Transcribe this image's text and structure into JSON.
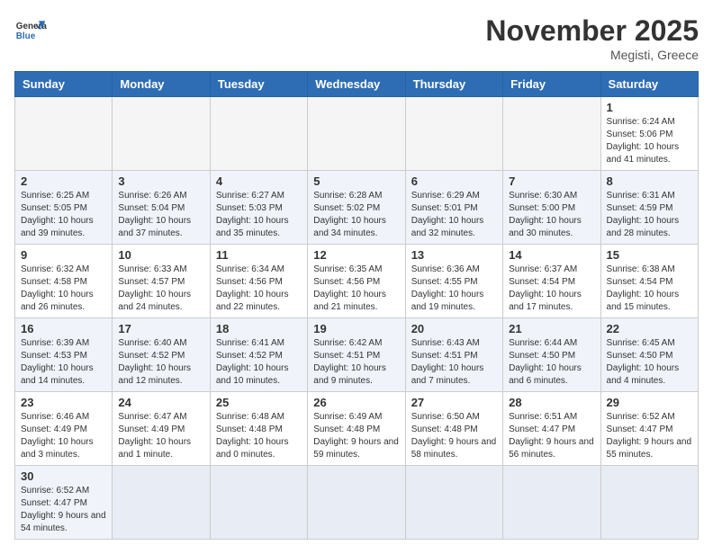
{
  "header": {
    "logo_general": "General",
    "logo_blue": "Blue",
    "month_title": "November 2025",
    "subtitle": "Megisti, Greece"
  },
  "weekdays": [
    "Sunday",
    "Monday",
    "Tuesday",
    "Wednesday",
    "Thursday",
    "Friday",
    "Saturday"
  ],
  "weeks": [
    [
      {
        "day": "",
        "info": ""
      },
      {
        "day": "",
        "info": ""
      },
      {
        "day": "",
        "info": ""
      },
      {
        "day": "",
        "info": ""
      },
      {
        "day": "",
        "info": ""
      },
      {
        "day": "",
        "info": ""
      },
      {
        "day": "1",
        "info": "Sunrise: 6:24 AM\nSunset: 5:06 PM\nDaylight: 10 hours and 41 minutes."
      }
    ],
    [
      {
        "day": "2",
        "info": "Sunrise: 6:25 AM\nSunset: 5:05 PM\nDaylight: 10 hours and 39 minutes."
      },
      {
        "day": "3",
        "info": "Sunrise: 6:26 AM\nSunset: 5:04 PM\nDaylight: 10 hours and 37 minutes."
      },
      {
        "day": "4",
        "info": "Sunrise: 6:27 AM\nSunset: 5:03 PM\nDaylight: 10 hours and 35 minutes."
      },
      {
        "day": "5",
        "info": "Sunrise: 6:28 AM\nSunset: 5:02 PM\nDaylight: 10 hours and 34 minutes."
      },
      {
        "day": "6",
        "info": "Sunrise: 6:29 AM\nSunset: 5:01 PM\nDaylight: 10 hours and 32 minutes."
      },
      {
        "day": "7",
        "info": "Sunrise: 6:30 AM\nSunset: 5:00 PM\nDaylight: 10 hours and 30 minutes."
      },
      {
        "day": "8",
        "info": "Sunrise: 6:31 AM\nSunset: 4:59 PM\nDaylight: 10 hours and 28 minutes."
      }
    ],
    [
      {
        "day": "9",
        "info": "Sunrise: 6:32 AM\nSunset: 4:58 PM\nDaylight: 10 hours and 26 minutes."
      },
      {
        "day": "10",
        "info": "Sunrise: 6:33 AM\nSunset: 4:57 PM\nDaylight: 10 hours and 24 minutes."
      },
      {
        "day": "11",
        "info": "Sunrise: 6:34 AM\nSunset: 4:56 PM\nDaylight: 10 hours and 22 minutes."
      },
      {
        "day": "12",
        "info": "Sunrise: 6:35 AM\nSunset: 4:56 PM\nDaylight: 10 hours and 21 minutes."
      },
      {
        "day": "13",
        "info": "Sunrise: 6:36 AM\nSunset: 4:55 PM\nDaylight: 10 hours and 19 minutes."
      },
      {
        "day": "14",
        "info": "Sunrise: 6:37 AM\nSunset: 4:54 PM\nDaylight: 10 hours and 17 minutes."
      },
      {
        "day": "15",
        "info": "Sunrise: 6:38 AM\nSunset: 4:54 PM\nDaylight: 10 hours and 15 minutes."
      }
    ],
    [
      {
        "day": "16",
        "info": "Sunrise: 6:39 AM\nSunset: 4:53 PM\nDaylight: 10 hours and 14 minutes."
      },
      {
        "day": "17",
        "info": "Sunrise: 6:40 AM\nSunset: 4:52 PM\nDaylight: 10 hours and 12 minutes."
      },
      {
        "day": "18",
        "info": "Sunrise: 6:41 AM\nSunset: 4:52 PM\nDaylight: 10 hours and 10 minutes."
      },
      {
        "day": "19",
        "info": "Sunrise: 6:42 AM\nSunset: 4:51 PM\nDaylight: 10 hours and 9 minutes."
      },
      {
        "day": "20",
        "info": "Sunrise: 6:43 AM\nSunset: 4:51 PM\nDaylight: 10 hours and 7 minutes."
      },
      {
        "day": "21",
        "info": "Sunrise: 6:44 AM\nSunset: 4:50 PM\nDaylight: 10 hours and 6 minutes."
      },
      {
        "day": "22",
        "info": "Sunrise: 6:45 AM\nSunset: 4:50 PM\nDaylight: 10 hours and 4 minutes."
      }
    ],
    [
      {
        "day": "23",
        "info": "Sunrise: 6:46 AM\nSunset: 4:49 PM\nDaylight: 10 hours and 3 minutes."
      },
      {
        "day": "24",
        "info": "Sunrise: 6:47 AM\nSunset: 4:49 PM\nDaylight: 10 hours and 1 minute."
      },
      {
        "day": "25",
        "info": "Sunrise: 6:48 AM\nSunset: 4:48 PM\nDaylight: 10 hours and 0 minutes."
      },
      {
        "day": "26",
        "info": "Sunrise: 6:49 AM\nSunset: 4:48 PM\nDaylight: 9 hours and 59 minutes."
      },
      {
        "day": "27",
        "info": "Sunrise: 6:50 AM\nSunset: 4:48 PM\nDaylight: 9 hours and 58 minutes."
      },
      {
        "day": "28",
        "info": "Sunrise: 6:51 AM\nSunset: 4:47 PM\nDaylight: 9 hours and 56 minutes."
      },
      {
        "day": "29",
        "info": "Sunrise: 6:52 AM\nSunset: 4:47 PM\nDaylight: 9 hours and 55 minutes."
      }
    ],
    [
      {
        "day": "30",
        "info": "Sunrise: 6:52 AM\nSunset: 4:47 PM\nDaylight: 9 hours and 54 minutes."
      },
      {
        "day": "",
        "info": ""
      },
      {
        "day": "",
        "info": ""
      },
      {
        "day": "",
        "info": ""
      },
      {
        "day": "",
        "info": ""
      },
      {
        "day": "",
        "info": ""
      },
      {
        "day": "",
        "info": ""
      }
    ]
  ]
}
